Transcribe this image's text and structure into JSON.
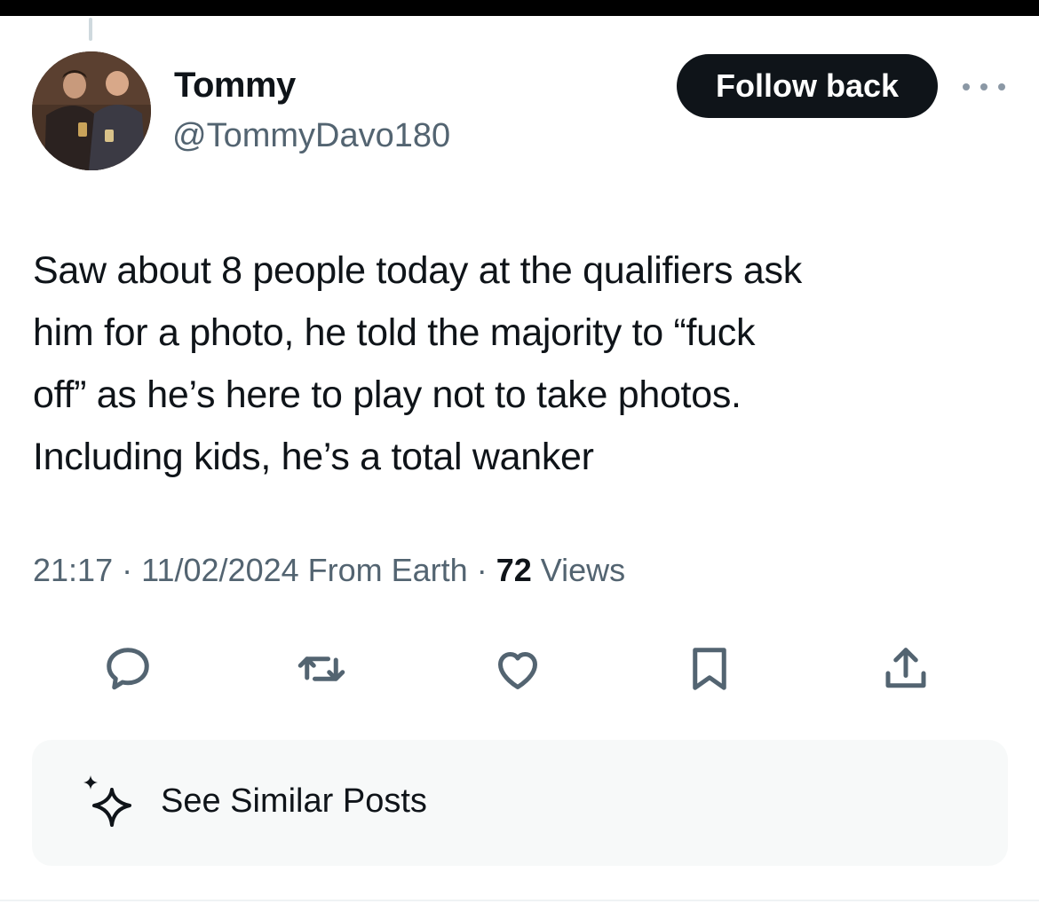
{
  "author": {
    "display_name": "Tommy",
    "handle": "@TommyDavo180",
    "avatar_icon": "profile-photo"
  },
  "header": {
    "follow_label": "Follow back",
    "more_icon": "ellipsis-icon"
  },
  "tweet": {
    "text_lines": [
      "Saw about 8 people today at the qualifiers ask",
      "him for a photo, he told the majority to “fuck",
      "off” as he’s here to play not to take photos.",
      "Including kids, he’s a total wanker"
    ],
    "time": "21:17",
    "date": "11/02/2024",
    "location": "From Earth",
    "views_count": "72",
    "views_label": "Views",
    "separator": "·"
  },
  "actions": [
    {
      "name": "reply",
      "icon": "speech-bubble-icon"
    },
    {
      "name": "repost",
      "icon": "repost-arrows-icon"
    },
    {
      "name": "like",
      "icon": "heart-icon"
    },
    {
      "name": "bookmark",
      "icon": "bookmark-icon"
    },
    {
      "name": "share",
      "icon": "share-upload-icon"
    }
  ],
  "similar": {
    "label": "See Similar Posts",
    "icon": "sparkle-icon"
  },
  "colors": {
    "text_primary": "#0f1419",
    "text_secondary": "#536471",
    "icon_gray": "#536471",
    "button_bg": "#0f1419",
    "card_bg": "#f7f9f9"
  }
}
